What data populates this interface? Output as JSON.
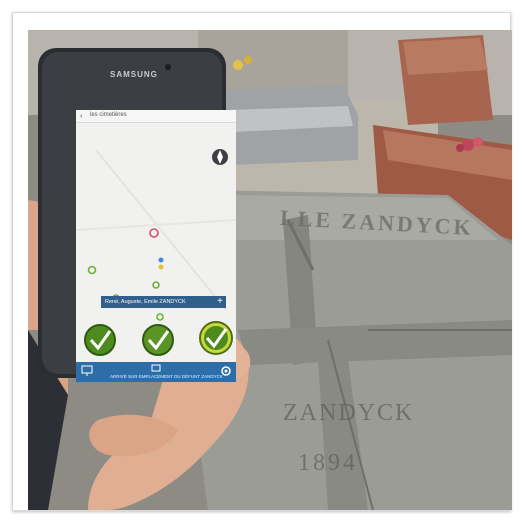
{
  "image": {
    "phone_brand": "SAMSUNG",
    "app": {
      "search_text": "les cimetières",
      "back_icon": "back-arrow-icon",
      "info_banner": "René, Auguste, Emile ZANDYCK",
      "add_icon": "plus-icon",
      "bottom_text": "ARRIVÉ SUR EMPLACEMENT DU DÉFUNT ZANDYCK",
      "icons": [
        "compass-icon",
        "check-icon",
        "screen-icon",
        "settings-icon"
      ]
    },
    "tombstone": {
      "top_text": "LLE ZANDYCK",
      "middle_text": "ZANDYCK",
      "lower_text": "1894"
    },
    "colors": {
      "app_blue": "#2d6ea8",
      "marker_green": "#6ab42f",
      "stone_gray": "#9b9b96"
    }
  }
}
